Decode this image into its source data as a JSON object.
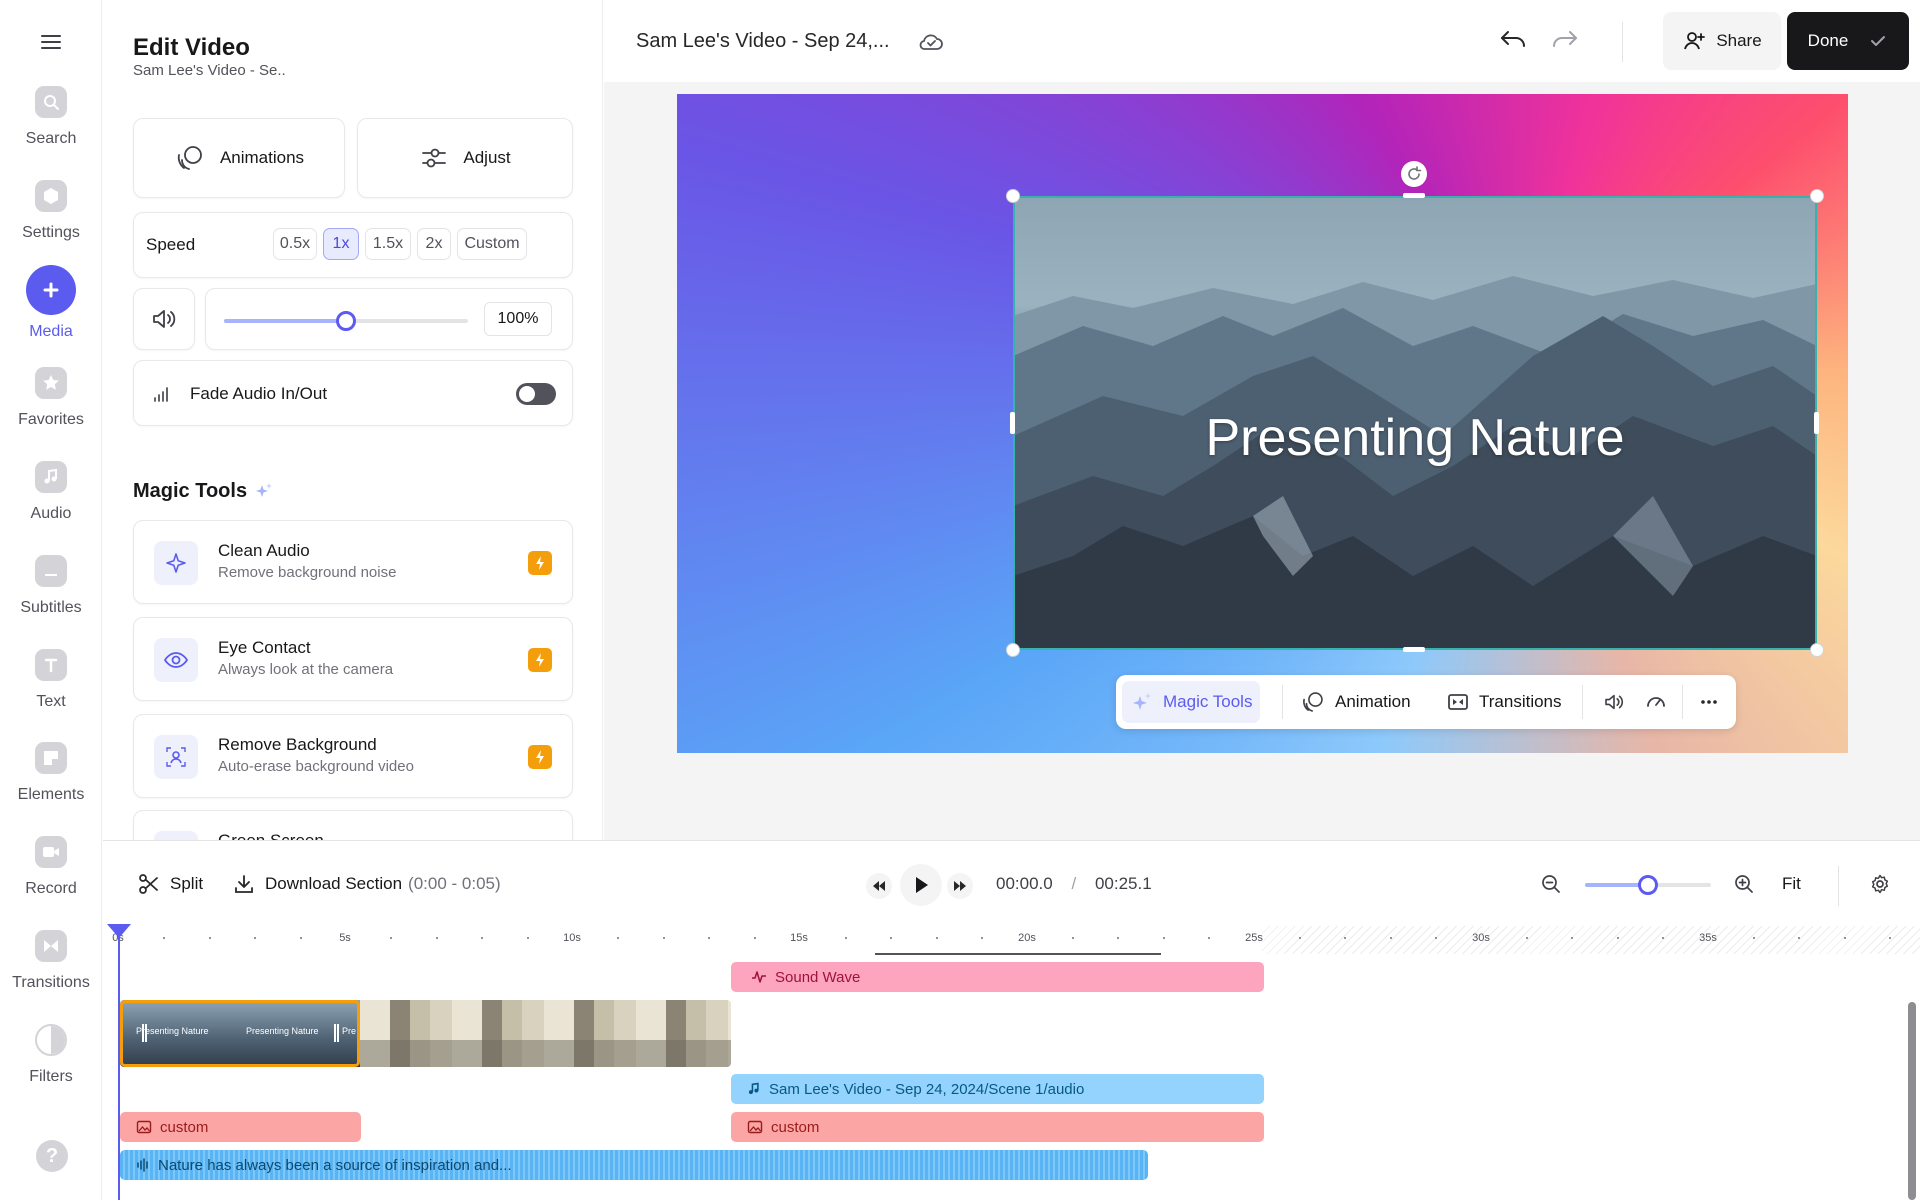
{
  "rail": {
    "items": [
      {
        "label": "Search",
        "icon": "search-icon"
      },
      {
        "label": "Settings",
        "icon": "settings-icon"
      },
      {
        "label": "Media",
        "icon": "plus-icon",
        "active": true
      },
      {
        "label": "Favorites",
        "icon": "star-icon"
      },
      {
        "label": "Audio",
        "icon": "music-note-icon"
      },
      {
        "label": "Subtitles",
        "icon": "subtitles-icon"
      },
      {
        "label": "Text",
        "icon": "text-icon"
      },
      {
        "label": "Elements",
        "icon": "elements-icon"
      },
      {
        "label": "Record",
        "icon": "camera-icon"
      },
      {
        "label": "Transitions",
        "icon": "transitions-icon"
      },
      {
        "label": "Filters",
        "icon": "filters-icon"
      }
    ],
    "help": "?"
  },
  "panel": {
    "title": "Edit Video",
    "subtitle": "Sam Lee's Video - Se..",
    "animations_label": "Animations",
    "adjust_label": "Adjust",
    "speed_label": "Speed",
    "speed_options": [
      "0.5x",
      "1x",
      "1.5x",
      "2x",
      "Custom"
    ],
    "speed_selected": "1x",
    "volume_value": "100%",
    "volume_level": 0.5,
    "fade_label": "Fade Audio In/Out",
    "fade_on": false,
    "magic_title": "Magic Tools",
    "tools": [
      {
        "title": "Clean Audio",
        "subtitle": "Remove background noise"
      },
      {
        "title": "Eye Contact",
        "subtitle": "Always look at the camera"
      },
      {
        "title": "Remove Background",
        "subtitle": "Auto-erase background video"
      },
      {
        "title": "Green Screen",
        "subtitle": ""
      }
    ]
  },
  "topbar": {
    "title": "Sam Lee's Video - Sep 24,...",
    "share_label": "Share",
    "done_label": "Done"
  },
  "canvas": {
    "overlay_text": "Presenting Nature",
    "context_menu": {
      "magic_tools": "Magic Tools",
      "animation": "Animation",
      "transitions": "Transitions"
    }
  },
  "timeline": {
    "split_label": "Split",
    "download_label": "Download Section",
    "download_range": "(0:00 - 0:05)",
    "current_time": "00:00.0",
    "separator": "/",
    "total_time": "00:25.1",
    "zoom_level": 0.5,
    "fit_label": "Fit",
    "ruler_labels": [
      "0s",
      "5s",
      "10s",
      "15s",
      "20s",
      "25s",
      "30s",
      "35s"
    ],
    "video_clip_texts": [
      "Presenting Nature",
      "Presenting Nature",
      "Pre"
    ],
    "sound_wave_label": "Sound Wave",
    "scene_audio_label": "Sam Lee's Video - Sep 24, 2024/Scene 1/audio",
    "custom_label_1": "custom",
    "custom_label_2": "custom",
    "voiceover_label": "Nature has always been a source of inspiration and..."
  },
  "colors": {
    "accent": "#5b5bf0",
    "sound_wave": "#fda4bf",
    "scene_audio": "#93d3fd",
    "custom": "#fca5a5",
    "voiceover": "#7ec7f9",
    "selection": "#f59e0b"
  }
}
